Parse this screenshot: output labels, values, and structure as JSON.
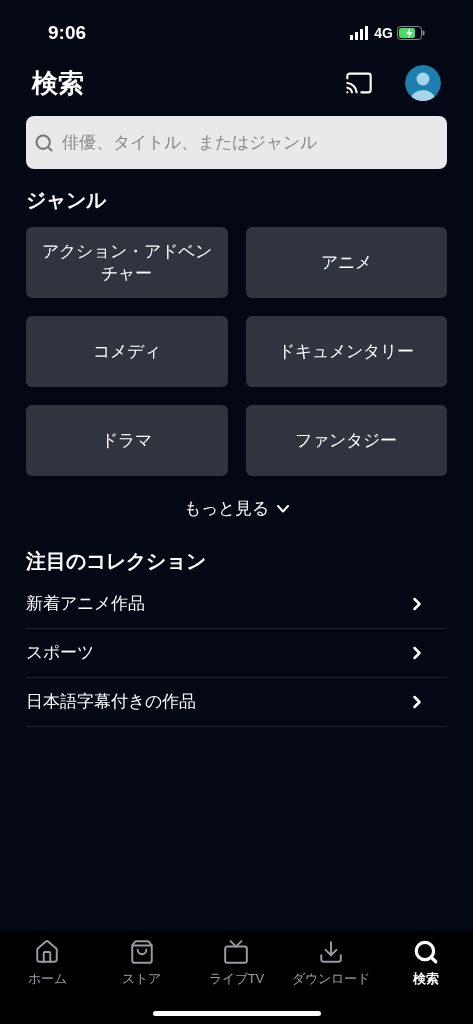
{
  "status_bar": {
    "time": "9:06",
    "network": "4G"
  },
  "header": {
    "title": "検索"
  },
  "search": {
    "placeholder": "俳優、タイトル、またはジャンル"
  },
  "genres": {
    "title": "ジャンル",
    "items": [
      "アクション・アドベンチャー",
      "アニメ",
      "コメディ",
      "ドキュメンタリー",
      "ドラマ",
      "ファンタジー"
    ],
    "more": "もっと見る"
  },
  "collections": {
    "title": "注目のコレクション",
    "items": [
      "新着アニメ作品",
      "スポーツ",
      "日本語字幕付きの作品"
    ]
  },
  "tab_bar": [
    {
      "kind": "home",
      "label": "ホーム",
      "selected": false
    },
    {
      "kind": "store",
      "label": "ストア",
      "selected": false
    },
    {
      "kind": "tv",
      "label": "ライブTV",
      "selected": false
    },
    {
      "kind": "download",
      "label": "ダウンロード",
      "selected": false
    },
    {
      "kind": "search",
      "label": "検索",
      "selected": true
    }
  ]
}
